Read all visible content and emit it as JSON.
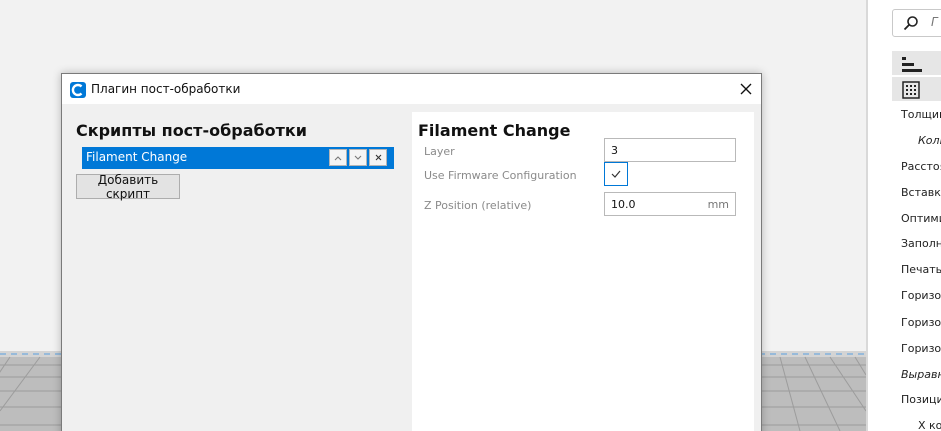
{
  "dialog": {
    "title": "Плагин пост-обработки",
    "left_heading": "Скрипты пост-обработки",
    "scripts": [
      {
        "label": "Filament Change",
        "selected": true
      }
    ],
    "add_script_label": "Добавить скрипт",
    "settings": {
      "heading": "Filament Change",
      "layer_label": "Layer",
      "layer_value": "3",
      "firmware_label": "Use Firmware Configuration",
      "firmware_checked": true,
      "z_label": "Z Position (relative)",
      "z_value": "10.0",
      "z_unit": "mm"
    }
  },
  "right_panel": {
    "search_placeholder": "Г",
    "settings_list": [
      {
        "label": "Толщин",
        "italic": false,
        "sub": false
      },
      {
        "label": "Колі",
        "italic": true,
        "sub": true
      },
      {
        "label": "Расстоя",
        "italic": false,
        "sub": false
      },
      {
        "label": "Вставка",
        "italic": false,
        "sub": false
      },
      {
        "label": "Оптими",
        "italic": false,
        "sub": false
      },
      {
        "label": "Заполне",
        "italic": false,
        "sub": false
      },
      {
        "label": "Печать",
        "italic": false,
        "sub": false
      },
      {
        "label": "Горизо",
        "italic": false,
        "sub": false
      },
      {
        "label": "Горизо",
        "italic": false,
        "sub": false
      },
      {
        "label": "Горизо",
        "italic": false,
        "sub": false
      },
      {
        "label": "Выравн",
        "italic": true,
        "sub": false
      },
      {
        "label": "Позици",
        "italic": false,
        "sub": false
      },
      {
        "label": "X ко",
        "italic": false,
        "sub": true
      }
    ]
  },
  "colors": {
    "accent": "#0078d7",
    "build_plate": "#b5b5b5"
  }
}
